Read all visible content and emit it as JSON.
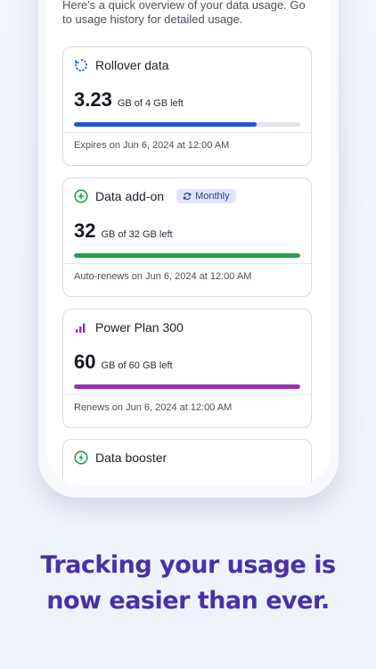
{
  "intro": "Here's a quick overview of your data usage. Go to usage history for detailed usage.",
  "cards": [
    {
      "title": "Rollover data",
      "icon": "rollover-icon",
      "amount": "3.23",
      "unit": "GB of 4 GB left",
      "fraction": 0.8075,
      "color": "#1f56d8",
      "footnote": "Expires on Jun 6, 2024 at 12:00 AM"
    },
    {
      "title": "Data add-on",
      "icon": "plus-circle-icon",
      "badge": "Monthly",
      "amount": "32",
      "unit": "GB of 32 GB left",
      "fraction": 1.0,
      "color": "#1ea34a",
      "footnote": "Auto-renews on Jun 6, 2024 at 12:00 AM"
    },
    {
      "title": "Power Plan 300",
      "icon": "signal-bars-icon",
      "amount": "60",
      "unit": "GB of 60 GB left",
      "fraction": 1.0,
      "color": "#9b2fb0",
      "footnote": "Renews on Jun 6, 2024 at 12:00 AM"
    },
    {
      "title": "Data booster",
      "icon": "lightning-circle-icon"
    }
  ],
  "tagline_line1": "Tracking your usage is",
  "tagline_line2": "now easier than ever."
}
